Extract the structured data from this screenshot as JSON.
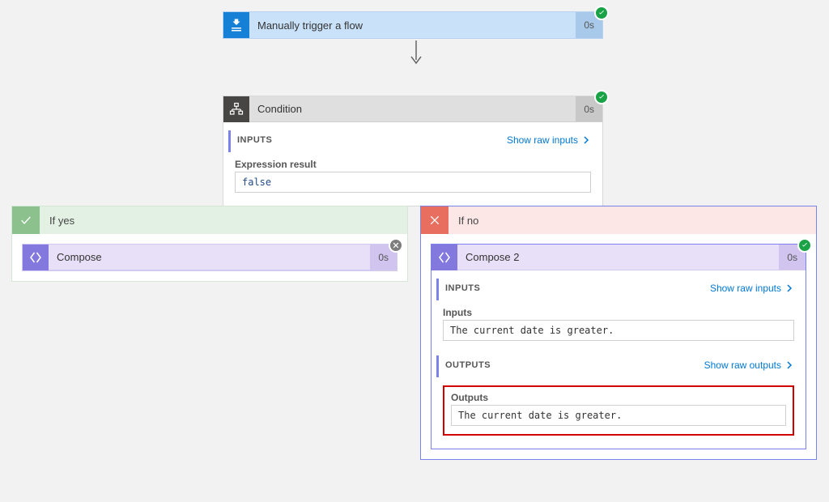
{
  "trigger": {
    "title": "Manually trigger a flow",
    "duration": "0s",
    "status": "success"
  },
  "condition": {
    "title": "Condition",
    "duration": "0s",
    "status": "success",
    "inputs_section_label": "INPUTS",
    "show_raw_inputs_label": "Show raw inputs",
    "expression_label": "Expression result",
    "expression_value": "false"
  },
  "branches": {
    "yes": {
      "label": "If yes",
      "compose": {
        "title": "Compose",
        "duration": "0s",
        "status": "skipped"
      }
    },
    "no": {
      "label": "If no",
      "compose": {
        "title": "Compose 2",
        "duration": "0s",
        "status": "success",
        "inputs_section_label": "INPUTS",
        "show_raw_inputs_label": "Show raw inputs",
        "inputs_field_label": "Inputs",
        "inputs_value": "The current date is greater.",
        "outputs_section_label": "OUTPUTS",
        "show_raw_outputs_label": "Show raw outputs",
        "outputs_field_label": "Outputs",
        "outputs_value": "The current date is greater."
      }
    }
  }
}
